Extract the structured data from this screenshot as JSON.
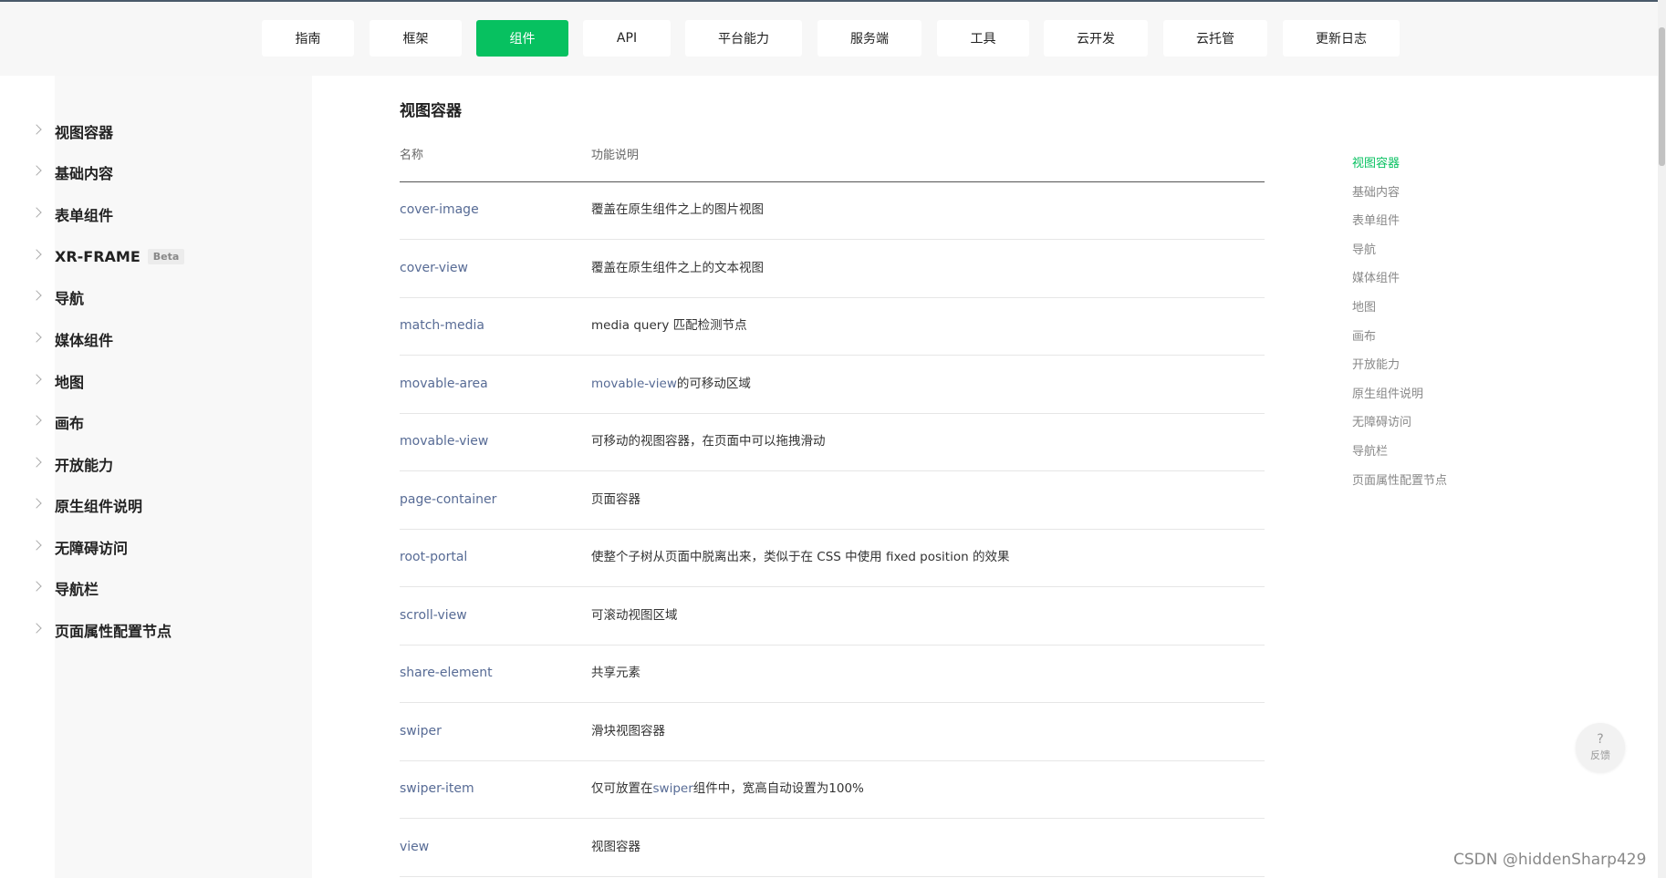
{
  "top_nav": {
    "items": [
      {
        "label": "指南"
      },
      {
        "label": "框架"
      },
      {
        "label": "组件",
        "active": true
      },
      {
        "label": "API"
      },
      {
        "label": "平台能力"
      },
      {
        "label": "服务端"
      },
      {
        "label": "工具"
      },
      {
        "label": "云开发"
      },
      {
        "label": "云托管"
      },
      {
        "label": "更新日志"
      }
    ],
    "active_color": "#07c160"
  },
  "sidebar": {
    "items": [
      {
        "label": "视图容器"
      },
      {
        "label": "基础内容"
      },
      {
        "label": "表单组件"
      },
      {
        "label": "XR-FRAME",
        "badge": "Beta"
      },
      {
        "label": "导航"
      },
      {
        "label": "媒体组件"
      },
      {
        "label": "地图"
      },
      {
        "label": "画布"
      },
      {
        "label": "开放能力"
      },
      {
        "label": "原生组件说明"
      },
      {
        "label": "无障碍访问"
      },
      {
        "label": "导航栏"
      },
      {
        "label": "页面属性配置节点"
      }
    ]
  },
  "main": {
    "title": "视图容器",
    "columns": {
      "name": "名称",
      "desc": "功能说明"
    },
    "rows": [
      {
        "name": "cover-image",
        "desc": "覆盖在原生组件之上的图片视图"
      },
      {
        "name": "cover-view",
        "desc": "覆盖在原生组件之上的文本视图"
      },
      {
        "name": "match-media",
        "desc": "media query 匹配检测节点"
      },
      {
        "name": "movable-area",
        "desc_link": "movable-view",
        "desc": "的可移动区域"
      },
      {
        "name": "movable-view",
        "desc": "可移动的视图容器，在页面中可以拖拽滑动"
      },
      {
        "name": "page-container",
        "desc": "页面容器"
      },
      {
        "name": "root-portal",
        "desc": "使整个子树从页面中脱离出来，类似于在 CSS 中使用 fixed position 的效果"
      },
      {
        "name": "scroll-view",
        "desc": "可滚动视图区域"
      },
      {
        "name": "share-element",
        "desc": "共享元素"
      },
      {
        "name": "swiper",
        "desc": "滑块视图容器"
      },
      {
        "name": "swiper-item",
        "desc_pre": "仅可放置在",
        "desc_link": "swiper",
        "desc": "组件中，宽高自动设置为100%"
      },
      {
        "name": "view",
        "desc": "视图容器"
      }
    ]
  },
  "toc": {
    "items": [
      {
        "label": "视图容器",
        "active": true
      },
      {
        "label": "基础内容"
      },
      {
        "label": "表单组件"
      },
      {
        "label": "导航"
      },
      {
        "label": "媒体组件"
      },
      {
        "label": "地图"
      },
      {
        "label": "画布"
      },
      {
        "label": "开放能力"
      },
      {
        "label": "原生组件说明"
      },
      {
        "label": "无障碍访问"
      },
      {
        "label": "导航栏"
      },
      {
        "label": "页面属性配置节点"
      }
    ]
  },
  "feedback": {
    "icon": "question-icon",
    "glyph": "?",
    "label": "反馈"
  },
  "watermark": "CSDN @hiddenSharp429",
  "colors": {
    "link": "#576b95",
    "accent": "#07c160"
  }
}
